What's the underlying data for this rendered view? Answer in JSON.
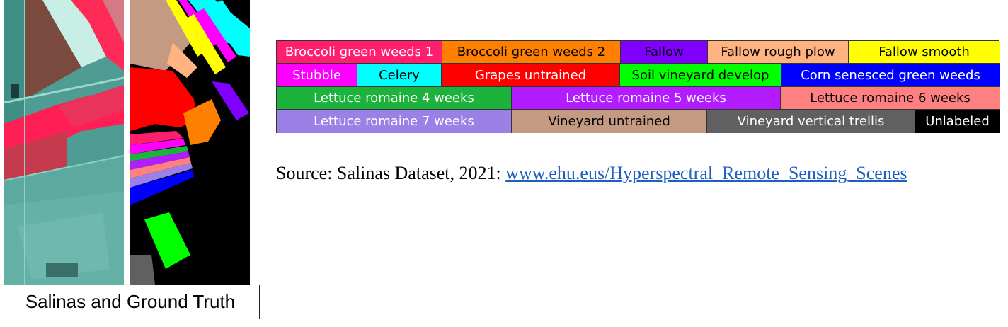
{
  "figure": {
    "caption": "Salinas and Ground Truth",
    "source_prefix": "Source: Salinas Dataset, 2021: ",
    "source_link": "www.ehu.eus/Hyperspectral_Remote_Sensing_Scenes"
  },
  "legend": {
    "rows": [
      [
        {
          "label": "Broccoli green weeds 1",
          "color": "#ff1f6e",
          "text_color": "#ffffff"
        },
        {
          "label": "Broccoli green weeds 2",
          "color": "#ff8000",
          "text_color": "#000000"
        },
        {
          "label": "Fallow",
          "color": "#8000ff",
          "text_color": "#000000"
        },
        {
          "label": "Fallow rough plow",
          "color": "#ffb380",
          "text_color": "#000000"
        },
        {
          "label": "Fallow smooth",
          "color": "#ffff00",
          "text_color": "#000000"
        }
      ],
      [
        {
          "label": "Stubble",
          "color": "#ff00ff",
          "text_color": "#ffffff"
        },
        {
          "label": "Celery",
          "color": "#00ffff",
          "text_color": "#000000"
        },
        {
          "label": "Grapes untrained",
          "color": "#ff0000",
          "text_color": "#ffffff"
        },
        {
          "label": "Soil vineyard develop",
          "color": "#00ff00",
          "text_color": "#000000"
        },
        {
          "label": "Corn senesced green weeds",
          "color": "#0000ff",
          "text_color": "#ffffff"
        }
      ],
      [
        {
          "label": "Lettuce romaine 4 weeks",
          "color": "#1cb33c",
          "text_color": "#ffffff"
        },
        {
          "label": "Lettuce romaine 5 weeks",
          "color": "#b31cff",
          "text_color": "#ffffff"
        },
        {
          "label": "Lettuce romaine 6 weeks",
          "color": "#ff8080",
          "text_color": "#000000"
        }
      ],
      [
        {
          "label": "Lettuce romaine 7 weeks",
          "color": "#9b80e6",
          "text_color": "#ffffff"
        },
        {
          "label": "Vineyard untrained",
          "color": "#c49a82",
          "text_color": "#000000"
        },
        {
          "label": "Vineyard vertical trellis",
          "color": "#606060",
          "text_color": "#ffffff"
        },
        {
          "label": "Unlabeled",
          "color": "#000000",
          "text_color": "#ffffff"
        }
      ]
    ]
  }
}
